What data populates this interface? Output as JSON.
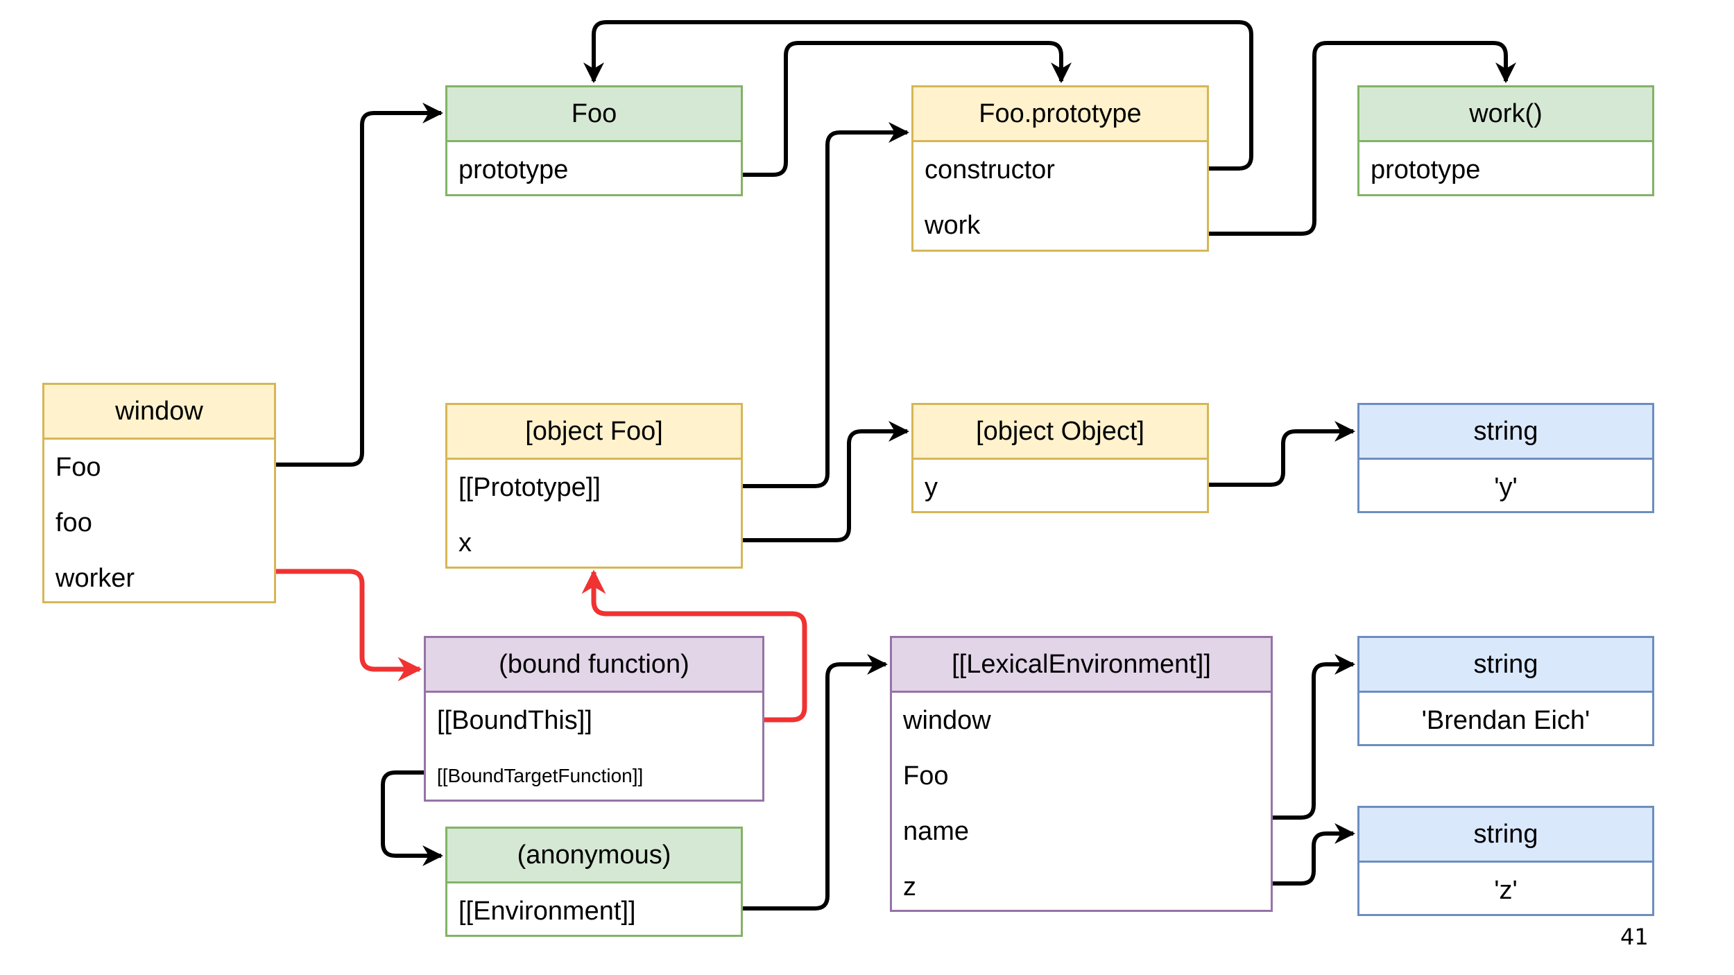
{
  "boxes": {
    "window": {
      "title": "window",
      "rows": [
        "Foo",
        "foo",
        "worker"
      ]
    },
    "foo_fn": {
      "title": "Foo",
      "rows": [
        "prototype"
      ]
    },
    "foo_proto": {
      "title": "Foo.prototype",
      "rows": [
        "constructor",
        "work"
      ]
    },
    "work_fn": {
      "title": "work()",
      "rows": [
        "prototype"
      ]
    },
    "object_foo": {
      "title": "[object Foo]",
      "rows": [
        "[[Prototype]]",
        "x"
      ]
    },
    "object_object": {
      "title": "[object Object]",
      "rows": [
        "y"
      ]
    },
    "string_y": {
      "title": "string",
      "rows": [
        "'y'"
      ]
    },
    "bound_fn": {
      "title": "(bound function)",
      "rows": [
        "[[BoundThis]]",
        "[[BoundTargetFunction]]"
      ]
    },
    "anonymous": {
      "title": "(anonymous)",
      "rows": [
        "[[Environment]]"
      ]
    },
    "lexical_env": {
      "title": "[[LexicalEnvironment]]",
      "rows": [
        "window",
        "Foo",
        "name",
        "z"
      ]
    },
    "string_name": {
      "title": "string",
      "rows": [
        "'Brendan Eich'"
      ]
    },
    "string_z": {
      "title": "string",
      "rows": [
        "'z'"
      ]
    }
  },
  "colors": {
    "edge": "#000000",
    "highlight_edge": "#f03232"
  },
  "edges": [
    {
      "from": "window.Foo",
      "to": "Foo",
      "highlight": false
    },
    {
      "from": "window.worker",
      "to": "(bound function)",
      "highlight": true
    },
    {
      "from": "Foo.prototype",
      "to": "Foo.prototype",
      "highlight": false
    },
    {
      "from": "Foo.prototype.constructor",
      "to": "Foo",
      "highlight": false
    },
    {
      "from": "Foo.prototype.work",
      "to": "work()",
      "highlight": false
    },
    {
      "from": "[object Foo].[[Prototype]]",
      "to": "Foo.prototype",
      "highlight": false
    },
    {
      "from": "[object Foo].x",
      "to": "[object Object]",
      "highlight": false
    },
    {
      "from": "[object Object].y",
      "to": "string 'y'",
      "highlight": false
    },
    {
      "from": "(bound function).[[BoundThis]]",
      "to": "[object Foo]",
      "highlight": true
    },
    {
      "from": "(bound function).[[BoundTargetFunction]]",
      "to": "(anonymous)",
      "highlight": false
    },
    {
      "from": "(anonymous).[[Environment]]",
      "to": "[[LexicalEnvironment]]",
      "highlight": false
    },
    {
      "from": "[[LexicalEnvironment]].name",
      "to": "string 'Brendan Eich'",
      "highlight": false
    },
    {
      "from": "[[LexicalEnvironment]].z",
      "to": "string 'z'",
      "highlight": false
    }
  ],
  "page_number": "41"
}
